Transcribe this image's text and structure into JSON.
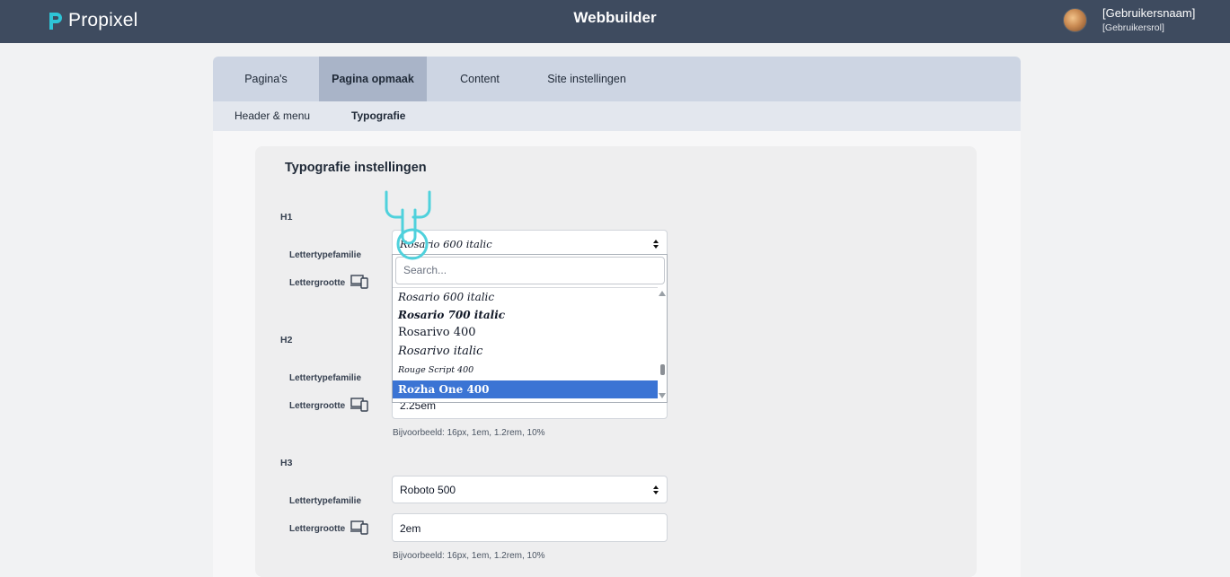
{
  "header": {
    "logo_text": "Propixel",
    "title": "Webbuilder",
    "user_name": "[Gebruikersnaam]",
    "user_role": "[Gebruikersrol]"
  },
  "tabs": [
    {
      "label": "Pagina's"
    },
    {
      "label": "Pagina opmaak"
    },
    {
      "label": "Content"
    },
    {
      "label": "Site instellingen"
    }
  ],
  "subtabs": [
    {
      "label": "Header & menu"
    },
    {
      "label": "Typografie"
    }
  ],
  "panel": {
    "title": "Typografie instellingen",
    "family_label": "Lettertypefamilie",
    "size_label": "Lettergrootte",
    "hint": "Bijvoorbeeld: 16px, 1em, 1.2rem, 10%",
    "h1": {
      "label": "H1",
      "family": "Rosario 600 italic"
    },
    "h2": {
      "label": "H2",
      "size": "2.25em"
    },
    "h3": {
      "label": "H3",
      "family": "Roboto 500",
      "size": "2em"
    }
  },
  "dropdown": {
    "search_placeholder": "Search...",
    "options": [
      "Rosario 600 italic",
      "Rosario 700 italic",
      "Rosarivo 400",
      "Rosarivo italic",
      "Rouge Script 400",
      "Rozha One 400"
    ],
    "selected_index": 5
  },
  "colors": {
    "topbar": "#3e4b5f",
    "accent_logo": "#2ec4d6",
    "selected_option": "#3b74d4",
    "active_tab": "#a9b4c8"
  }
}
